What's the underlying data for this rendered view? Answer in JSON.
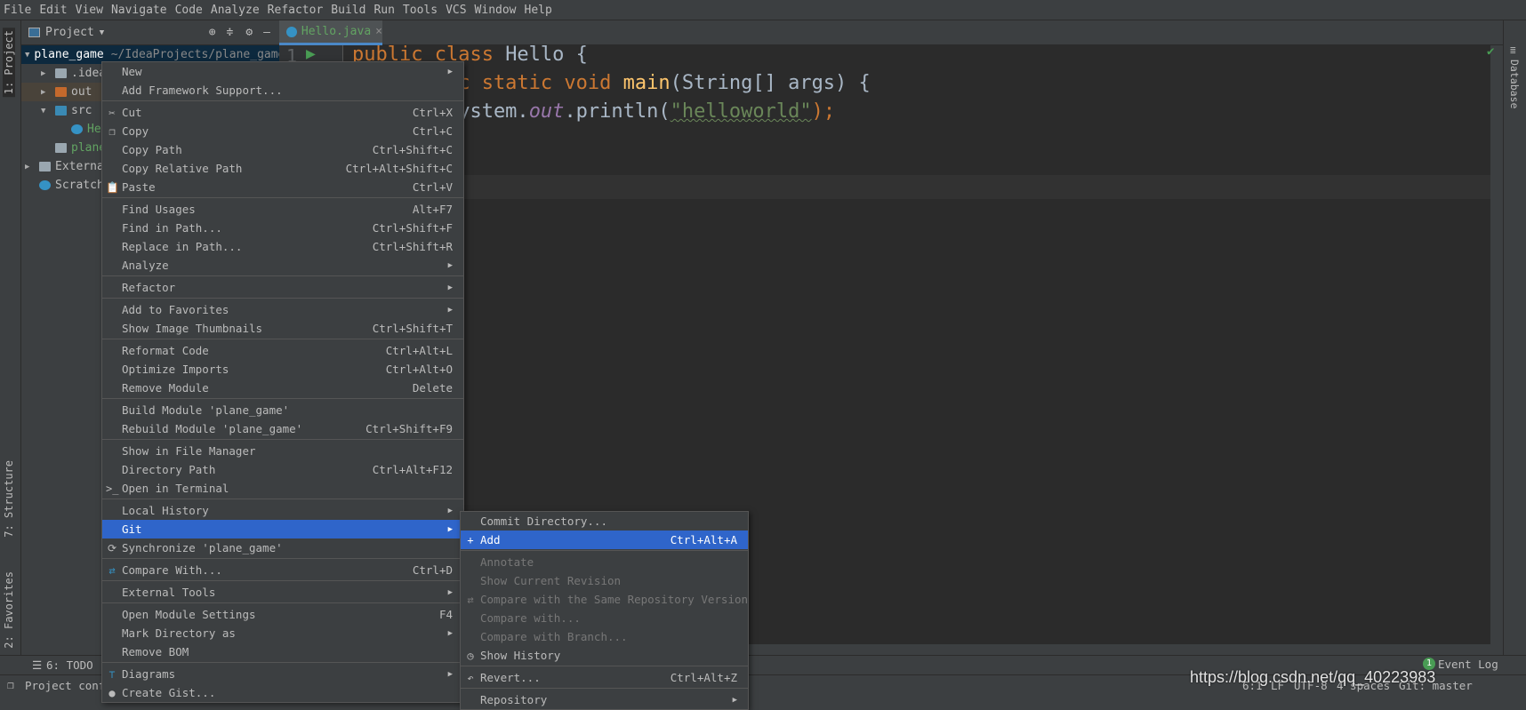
{
  "menubar": [
    "File",
    "Edit",
    "View",
    "Navigate",
    "Code",
    "Analyze",
    "Refactor",
    "Build",
    "Run",
    "Tools",
    "VCS",
    "Window",
    "Help"
  ],
  "left_strip": {
    "project": "1: Project",
    "structure": "7: Structure",
    "favorites": "2: Favorites"
  },
  "project_panel": {
    "title": "Project",
    "tree": [
      {
        "label": "plane_game",
        "hint": "~/IdeaProjects/plane_game",
        "icon": "module-folder-icon",
        "depth": 0,
        "arrow": "▼",
        "color": "#ffffff",
        "selected": true
      },
      {
        "label": ".idea",
        "icon": "folder-icon",
        "depth": 1,
        "arrow": "▶",
        "color": "#bbbbbb"
      },
      {
        "label": "out",
        "icon": "excluded-folder-icon",
        "depth": 1,
        "arrow": "▶",
        "color": "#bbbbbb",
        "excluded": true
      },
      {
        "label": "src",
        "icon": "source-folder-icon",
        "depth": 1,
        "arrow": "▼",
        "color": "#bbbbbb"
      },
      {
        "label": "Hello",
        "icon": "java-class-icon",
        "depth": 2,
        "arrow": "",
        "color": "#62a362"
      },
      {
        "label": "plane_game.iml",
        "icon": "iml-file-icon",
        "depth": 1,
        "arrow": "",
        "color": "#62a362"
      },
      {
        "label": "External Libraries",
        "icon": "libraries-icon",
        "depth": 0,
        "arrow": "▶",
        "color": "#bbbbbb"
      },
      {
        "label": "Scratches and Consoles",
        "icon": "scratches-icon",
        "depth": 0,
        "arrow": "",
        "color": "#bbbbbb"
      }
    ]
  },
  "editor": {
    "tab": "Hello.java",
    "line_number": "1",
    "lines": [
      [
        [
          "kw",
          "public class "
        ],
        [
          "",
          "Hello {"
        ]
      ],
      [
        [
          "kw",
          "    public static void "
        ],
        [
          "fn",
          "main"
        ],
        [
          "",
          "(String[] args) {"
        ]
      ],
      [
        [
          "",
          "        System."
        ],
        [
          "it",
          "out"
        ],
        [
          "",
          ".println("
        ],
        [
          "str",
          "\"helloworld\""
        ],
        [
          "kw",
          ");"
        ]
      ]
    ]
  },
  "right_strip": {
    "database": "Database"
  },
  "context_menu": [
    {
      "label": "New",
      "sub": true
    },
    {
      "label": "Add Framework Support..."
    },
    {
      "sep": true
    },
    {
      "label": "Cut",
      "shortcut": "Ctrl+X",
      "icon": "✂",
      "iconname": "cut-icon"
    },
    {
      "label": "Copy",
      "shortcut": "Ctrl+C",
      "icon": "❐",
      "iconname": "copy-icon"
    },
    {
      "label": "Copy Path",
      "shortcut": "Ctrl+Shift+C"
    },
    {
      "label": "Copy Relative Path",
      "shortcut": "Ctrl+Alt+Shift+C"
    },
    {
      "label": "Paste",
      "shortcut": "Ctrl+V",
      "icon": "📋",
      "iconname": "paste-icon"
    },
    {
      "sep": true
    },
    {
      "label": "Find Usages",
      "shortcut": "Alt+F7"
    },
    {
      "label": "Find in Path...",
      "shortcut": "Ctrl+Shift+F"
    },
    {
      "label": "Replace in Path...",
      "shortcut": "Ctrl+Shift+R"
    },
    {
      "label": "Analyze",
      "sub": true
    },
    {
      "sep": true
    },
    {
      "label": "Refactor",
      "sub": true
    },
    {
      "sep": true
    },
    {
      "label": "Add to Favorites",
      "sub": true
    },
    {
      "label": "Show Image Thumbnails",
      "shortcut": "Ctrl+Shift+T"
    },
    {
      "sep": true
    },
    {
      "label": "Reformat Code",
      "shortcut": "Ctrl+Alt+L"
    },
    {
      "label": "Optimize Imports",
      "shortcut": "Ctrl+Alt+O"
    },
    {
      "label": "Remove Module",
      "shortcut": "Delete"
    },
    {
      "sep": true
    },
    {
      "label": "Build Module 'plane_game'"
    },
    {
      "label": "Rebuild Module 'plane_game'",
      "shortcut": "Ctrl+Shift+F9"
    },
    {
      "sep": true
    },
    {
      "label": "Show in File Manager"
    },
    {
      "label": "Directory Path",
      "shortcut": "Ctrl+Alt+F12"
    },
    {
      "label": "Open in Terminal",
      "icon": ">_",
      "iconname": "terminal-icon"
    },
    {
      "sep": true
    },
    {
      "label": "Local History",
      "sub": true
    },
    {
      "label": "Git",
      "sub": true,
      "selected": true
    },
    {
      "label": "Synchronize 'plane_game'",
      "icon": "⟳",
      "iconname": "sync-icon"
    },
    {
      "sep": true
    },
    {
      "label": "Compare With...",
      "shortcut": "Ctrl+D",
      "icon": "⇄",
      "iconname": "compare-icon",
      "iconcolor": "#3592c4"
    },
    {
      "sep": true
    },
    {
      "label": "External Tools",
      "sub": true
    },
    {
      "sep": true
    },
    {
      "label": "Open Module Settings",
      "shortcut": "F4"
    },
    {
      "label": "Mark Directory as",
      "sub": true
    },
    {
      "label": "Remove BOM"
    },
    {
      "sep": true
    },
    {
      "label": "Diagrams",
      "sub": true,
      "icon": "⊤",
      "iconname": "diagrams-icon",
      "iconcolor": "#3592c4"
    },
    {
      "label": "Create Gist...",
      "icon": "●",
      "iconname": "github-icon"
    }
  ],
  "git_submenu": [
    {
      "label": "Commit Directory..."
    },
    {
      "label": "Add",
      "shortcut": "Ctrl+Alt+A",
      "icon": "+",
      "iconname": "plus-icon",
      "selected": true
    },
    {
      "sep": true
    },
    {
      "label": "Annotate",
      "disabled": true
    },
    {
      "label": "Show Current Revision",
      "disabled": true
    },
    {
      "label": "Compare with the Same Repository Version",
      "disabled": true,
      "icon": "⇄",
      "iconname": "compare-icon"
    },
    {
      "label": "Compare with...",
      "disabled": true
    },
    {
      "label": "Compare with Branch...",
      "disabled": true
    },
    {
      "label": "Show History",
      "icon": "◷",
      "iconname": "clock-icon"
    },
    {
      "sep": true
    },
    {
      "label": "Revert...",
      "shortcut": "Ctrl+Alt+Z",
      "icon": "↶",
      "iconname": "revert-icon"
    },
    {
      "sep": true
    },
    {
      "label": "Repository",
      "sub": true
    }
  ],
  "bottom_bar": {
    "todo": "6: TODO",
    "event_log": "Event Log",
    "event_count": "1"
  },
  "status_bar": {
    "message": "Project configurations files can be added to Git",
    "position": "6:1",
    "line_sep": "LF",
    "encoding": "UTF-8",
    "indent": "4 spaces",
    "branch": "Git: master"
  },
  "watermark": "https://blog.csdn.net/qq_40223983",
  "colors": {
    "selection": "#2f65ca",
    "background": "#3c3f41",
    "editor": "#2b2b2b",
    "keyword": "#cc7832"
  }
}
